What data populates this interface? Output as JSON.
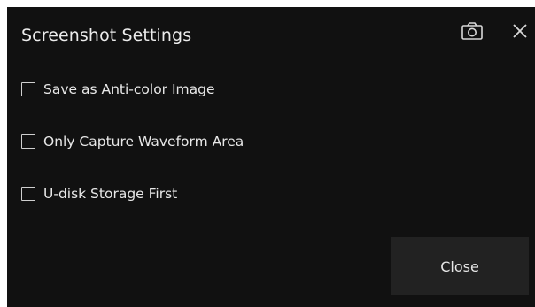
{
  "dialog": {
    "title": "Screenshot Settings",
    "header_icons": [
      "camera-icon",
      "close-icon"
    ],
    "options": [
      {
        "label": "Save as Anti-color Image",
        "checked": false
      },
      {
        "label": "Only Capture Waveform Area",
        "checked": false
      },
      {
        "label": "U-disk Storage First",
        "checked": false
      }
    ],
    "close_label": "Close"
  },
  "colors": {
    "background": "#111111",
    "text": "#e6e6e6",
    "button_bg": "#222222"
  }
}
